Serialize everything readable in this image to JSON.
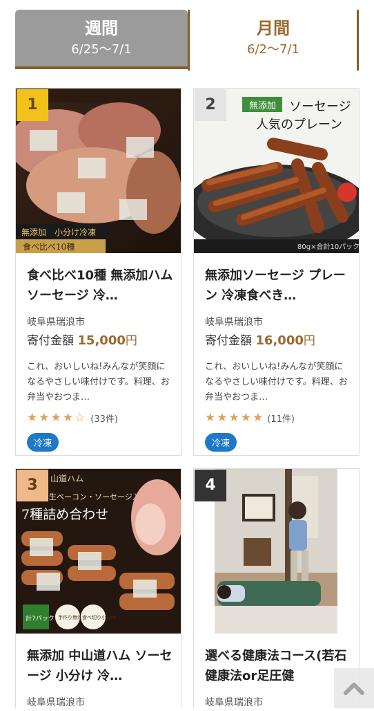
{
  "tabs": [
    {
      "title": "週間",
      "period": "6/25〜7/1"
    },
    {
      "title": "月間",
      "period": "6/2〜7/1"
    }
  ],
  "products": [
    {
      "rank": "1",
      "photo_caption_1": "無添加　小分け冷凍",
      "photo_caption_2": "食べ比べ10種",
      "name": "食べ比べ10種 無添加ハム ソーセージ 冷…",
      "location": "岐阜県瑞浪市",
      "price_label": "寄付金額",
      "price_amount": "15,000",
      "price_unit": "円",
      "description": "これ、おいしいね!みんなが笑顔になるやさしい味付けです。料理、お弁当やおつま…",
      "rating": 4.5,
      "review_count": "(33件)",
      "tag": "冷凍"
    },
    {
      "rank": "2",
      "photo_badge": "無添加",
      "photo_title": "ソーセージ",
      "photo_subtitle": "人気のプレーン",
      "photo_note": "80g×合計10パック",
      "name": "無添加ソーセージ プレーン 冷凍食べき…",
      "location": "岐阜県瑞浪市",
      "price_label": "寄付金額",
      "price_amount": "16,000",
      "price_unit": "円",
      "description": "これ、おいしいね!みんなが笑顔になるやさしい味付けです。料理、お弁当やおつま…",
      "rating": 5,
      "review_count": "(11件)",
      "tag": "冷凍"
    },
    {
      "rank": "3",
      "photo_caption_top": "山道ハム",
      "photo_caption_sub": "生ベーコン・ソーセージ入り",
      "photo_caption_main": "7種詰め合わせ",
      "photo_badge_1": "計7パック",
      "photo_badge_2": "手作り無添加",
      "photo_badge_3": "食べ切り小分け",
      "name": "無添加 中山道ハム ソーセージ 小分け 冷…",
      "location": "岐阜県瑞浪市"
    },
    {
      "rank": "4",
      "name": "選べる健康法コース(若石健康法or足圧健",
      "location": "岐阜県瑞浪市"
    }
  ],
  "icons": {
    "star": "star-icon",
    "half_star": "half-star-icon",
    "to_top": "chevron-up-icon"
  },
  "colors": {
    "accent_brown": "#9a6a2e",
    "tag_blue": "#1f78c8",
    "star": "#e0a25a"
  }
}
